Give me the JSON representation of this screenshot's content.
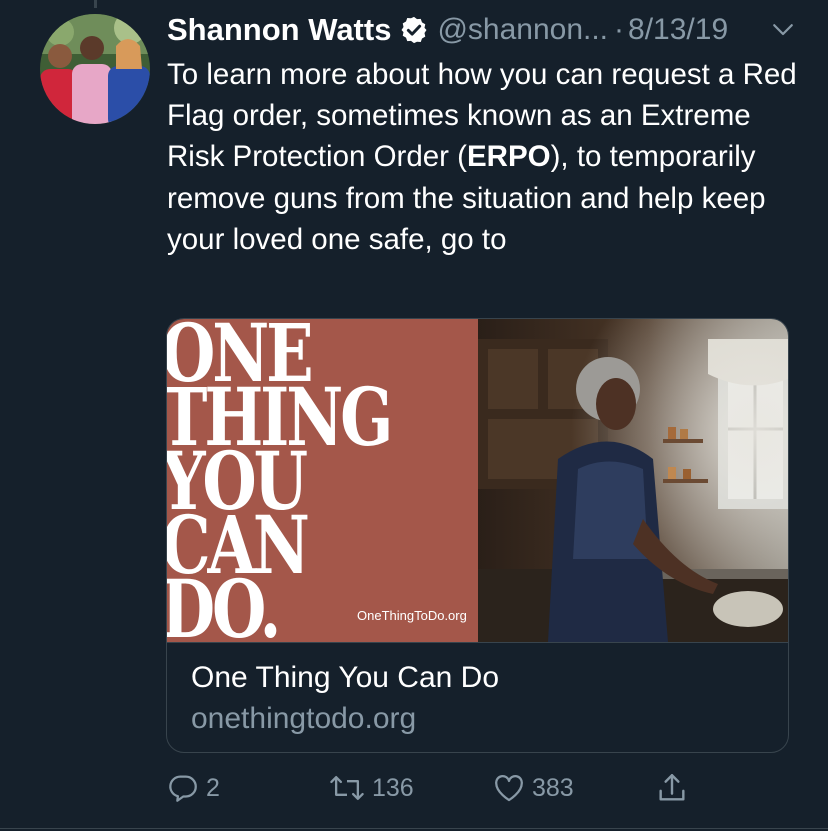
{
  "tweet": {
    "author_name": "Shannon Watts",
    "handle": "@shannon...",
    "separator": "·",
    "date": "8/13/19",
    "text_before": "To learn more about how you can request a Red Flag order, sometimes known as an Extreme Risk Protection Order (",
    "text_bold": "ERPO",
    "text_after": "), to temporarily remove guns from the situation and help keep your loved one safe, go to"
  },
  "card": {
    "poster_lines": [
      "ONE",
      "THING",
      "YOU",
      "CAN",
      "DO."
    ],
    "poster_url": "OneThingToDo.org",
    "title": "One Thing You Can Do",
    "domain": "onethingtodo.org"
  },
  "actions": {
    "reply_count": "2",
    "retweet_count": "136",
    "like_count": "383"
  },
  "icons": {
    "verified": "verified-badge-icon",
    "caret": "chevron-down-icon",
    "reply": "reply-icon",
    "retweet": "retweet-icon",
    "like": "heart-icon",
    "share": "share-icon"
  },
  "colors": {
    "background": "#15202b",
    "secondary_text": "#8899a6",
    "card_poster": "#a4574a",
    "border": "#38444d"
  }
}
